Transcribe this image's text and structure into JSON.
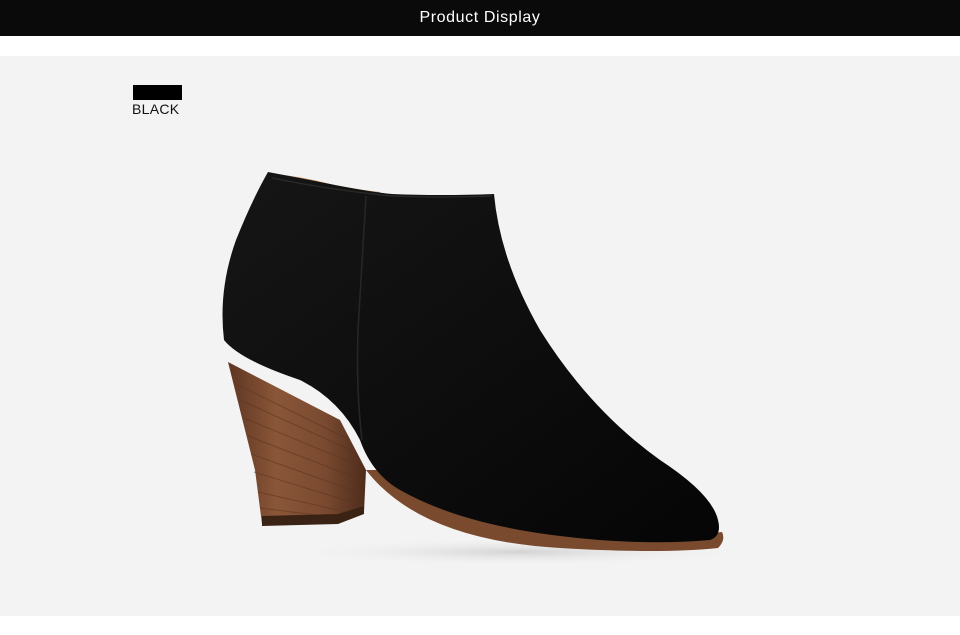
{
  "header": {
    "title": "Product Display"
  },
  "product": {
    "color_name": "BLACK",
    "swatch_color": "#000000"
  },
  "colors": {
    "header_bg": "#0a0a0a",
    "stage_bg": "#f3f3f3",
    "suede": "#0d0d0d",
    "heel_wood": "#7a4a30",
    "lining": "#b98a4e"
  }
}
